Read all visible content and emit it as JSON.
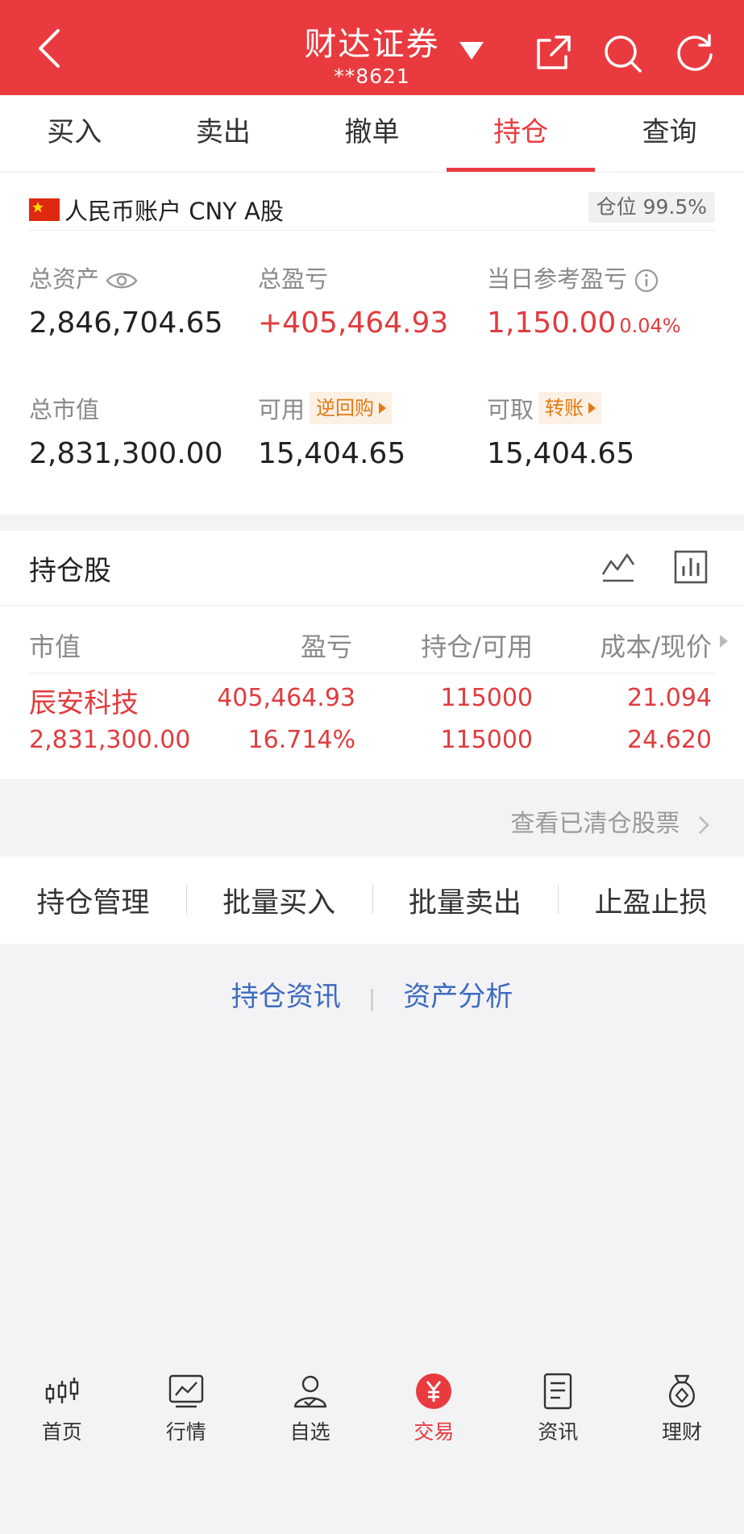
{
  "header": {
    "title": "财达证券",
    "account": "**8621",
    "icons": [
      "back-icon",
      "caret-down-icon",
      "share-icon",
      "search-icon",
      "refresh-icon"
    ]
  },
  "tabs": [
    {
      "label": "买入",
      "active": false
    },
    {
      "label": "卖出",
      "active": false
    },
    {
      "label": "撤单",
      "active": false
    },
    {
      "label": "持仓",
      "active": true
    },
    {
      "label": "查询",
      "active": false
    }
  ],
  "account": {
    "label": "人民币账户 CNY A股",
    "position_label": "仓位 99.5%"
  },
  "stats": {
    "total_assets": {
      "label": "总资产",
      "value": "2,846,704.65"
    },
    "total_pnl": {
      "label": "总盈亏",
      "value": "+405,464.93"
    },
    "daily_pnl": {
      "label": "当日参考盈亏",
      "value": "1,150.00",
      "pct": "0.04%"
    },
    "market_value": {
      "label": "总市值",
      "value": "2,831,300.00"
    },
    "available": {
      "label": "可用",
      "tag": "逆回购",
      "value": "15,404.65"
    },
    "withdrawable": {
      "label": "可取",
      "tag": "转账",
      "value": "15,404.65"
    }
  },
  "holdings": {
    "title": "持仓股",
    "columns": [
      "市值",
      "盈亏",
      "持仓/可用",
      "成本/现价"
    ],
    "rows": [
      {
        "name": "辰安科技",
        "market_value": "2,831,300.00",
        "pnl": "405,464.93",
        "pnl_pct": "16.714%",
        "position": "115000",
        "available": "115000",
        "cost": "21.094",
        "price": "24.620"
      }
    ],
    "cleared_link": "查看已清仓股票"
  },
  "actions": [
    "持仓管理",
    "批量买入",
    "批量卖出",
    "止盈止损"
  ],
  "links": [
    "持仓资讯",
    "资产分析"
  ],
  "nav": [
    {
      "label": "首页",
      "icon": "candlestick-icon",
      "active": false
    },
    {
      "label": "行情",
      "icon": "chart-icon",
      "active": false
    },
    {
      "label": "自选",
      "icon": "user-check-icon",
      "active": false
    },
    {
      "label": "交易",
      "icon": "yuan-icon",
      "active": true
    },
    {
      "label": "资讯",
      "icon": "document-icon",
      "active": false
    },
    {
      "label": "理财",
      "icon": "money-bag-icon",
      "active": false
    }
  ],
  "colors": {
    "brand": "#e93b3f",
    "profit": "#e03c3f",
    "link": "#3d6bbf",
    "tag": "#e07b15"
  }
}
